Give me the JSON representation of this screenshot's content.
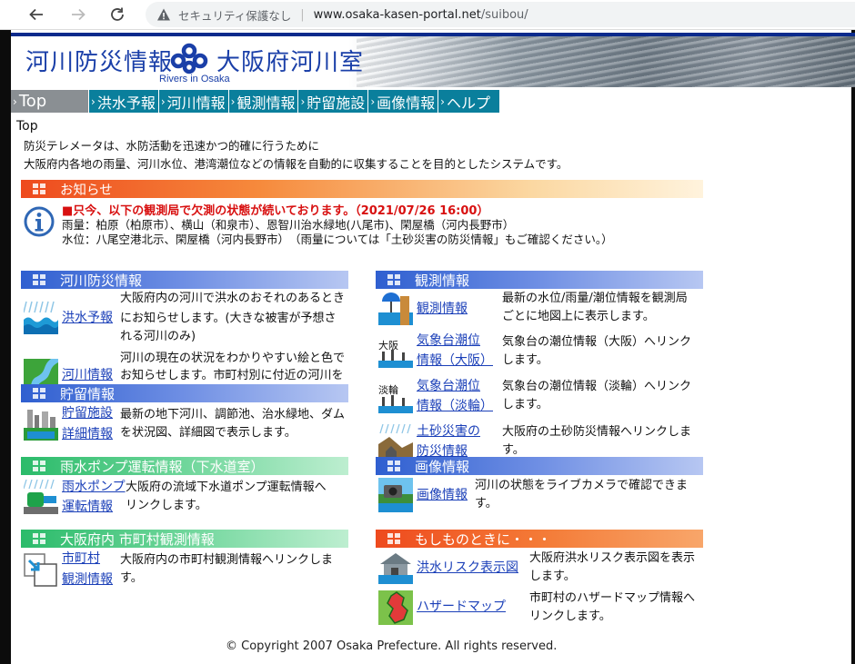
{
  "browser": {
    "security_label": "セキュリティ保護なし",
    "url_host": "www.osaka-kasen-portal.net",
    "url_path": "/suibou/"
  },
  "header": {
    "title": "河川防災情報",
    "org": "大阪府河川室",
    "subtitle": "Rivers in Osaka"
  },
  "tabs": [
    {
      "label": "Top"
    },
    {
      "label": "洪水予報"
    },
    {
      "label": "河川情報"
    },
    {
      "label": "観測情報"
    },
    {
      "label": "貯留施設"
    },
    {
      "label": "画像情報"
    },
    {
      "label": "ヘルプ"
    }
  ],
  "breadcrumb": "Top",
  "intro": [
    "防災テレメータは、水防活動を迅速かつ的確に行うために",
    "大阪府内各地の雨量、河川水位、港湾潮位などの情報を自動的に収集することを目的としたシステムです。"
  ],
  "notice": {
    "title": "お知らせ",
    "headline": "■只今、以下の観測局で欠測の状態が続いております。（2021/07/26 16:00）",
    "lines": [
      "雨量：柏原（柏原市）、横山（和泉市）、恩智川治水緑地(八尾市)、閑屋橋（河内長野市）",
      "水位：八尾空港北示、閑屋橋（河内長野市）　（雨量については「土砂災害の防災情報」もご確認ください。）"
    ]
  },
  "sections": {
    "river": {
      "title": "河川防災情報",
      "items": [
        {
          "link": "洪水予報",
          "desc": [
            "大阪府内の河川で洪水のおそれのあるとき",
            "にお知らせします。(大きな被害が予想さ",
            "れる河川のみ)"
          ]
        },
        {
          "link": "河川情報",
          "desc": [
            "河川の現在の状況をわかりやすい絵と色で",
            "お知らせします。市町村別に付近の河川を"
          ]
        }
      ]
    },
    "storage": {
      "title": "貯留情報",
      "items": [
        {
          "link1": "貯留施設",
          "link2": "詳細情報",
          "desc": [
            "最新の地下河川、調節池、治水緑地、ダム",
            "を状況図、詳細図で表示します。"
          ]
        }
      ]
    },
    "pump": {
      "title": "雨水ポンプ運転情報（下水道室）",
      "items": [
        {
          "link1": "雨水ポンプ",
          "link2": "運転情報",
          "desc": [
            "大阪府の流域下水道ポンプ運転情報へ",
            "リンクします。"
          ]
        }
      ]
    },
    "municipal": {
      "title": "大阪府内 市町村観測情報",
      "items": [
        {
          "link1": "市町村",
          "link2": "観測情報",
          "desc": [
            "大阪府内の市町村観測情報へリンクしま",
            "す。"
          ]
        }
      ]
    },
    "observation": {
      "title": "観測情報",
      "items": [
        {
          "link": "観測情報",
          "desc": [
            "最新の水位/雨量/潮位情報を観測局",
            "ごとに地図上に表示します。"
          ]
        },
        {
          "prefix": "大阪",
          "link1": "気象台潮位",
          "link2": "情報（大阪）",
          "desc": [
            "気象台の潮位情報（大阪）へリンク",
            "します。"
          ]
        },
        {
          "prefix": "淡輪",
          "link1": "気象台潮位",
          "link2": "情報（淡輪）",
          "desc": [
            "気象台の潮位情報（淡輪）へリンク",
            "します。"
          ]
        },
        {
          "link1": "土砂災害の",
          "link2": "防災情報",
          "desc": [
            "大阪府の土砂防災情報へリンクしま",
            "す。"
          ]
        }
      ]
    },
    "image": {
      "title": "画像情報",
      "items": [
        {
          "link": "画像情報",
          "desc": [
            "河川の状態をライブカメラで確認できま",
            "す。"
          ]
        }
      ]
    },
    "emergency": {
      "title": "もしものときに・・・",
      "items": [
        {
          "link": "洪水リスク表示図",
          "desc": [
            "大阪府洪水リスク表示図を表示",
            "します。"
          ]
        },
        {
          "link": "ハザードマップ",
          "desc": [
            "市町村のハザードマップ情報へ",
            "リンクします。"
          ]
        }
      ]
    }
  },
  "copyright": "© Copyright 2007 Osaka Prefecture. All rights reserved."
}
